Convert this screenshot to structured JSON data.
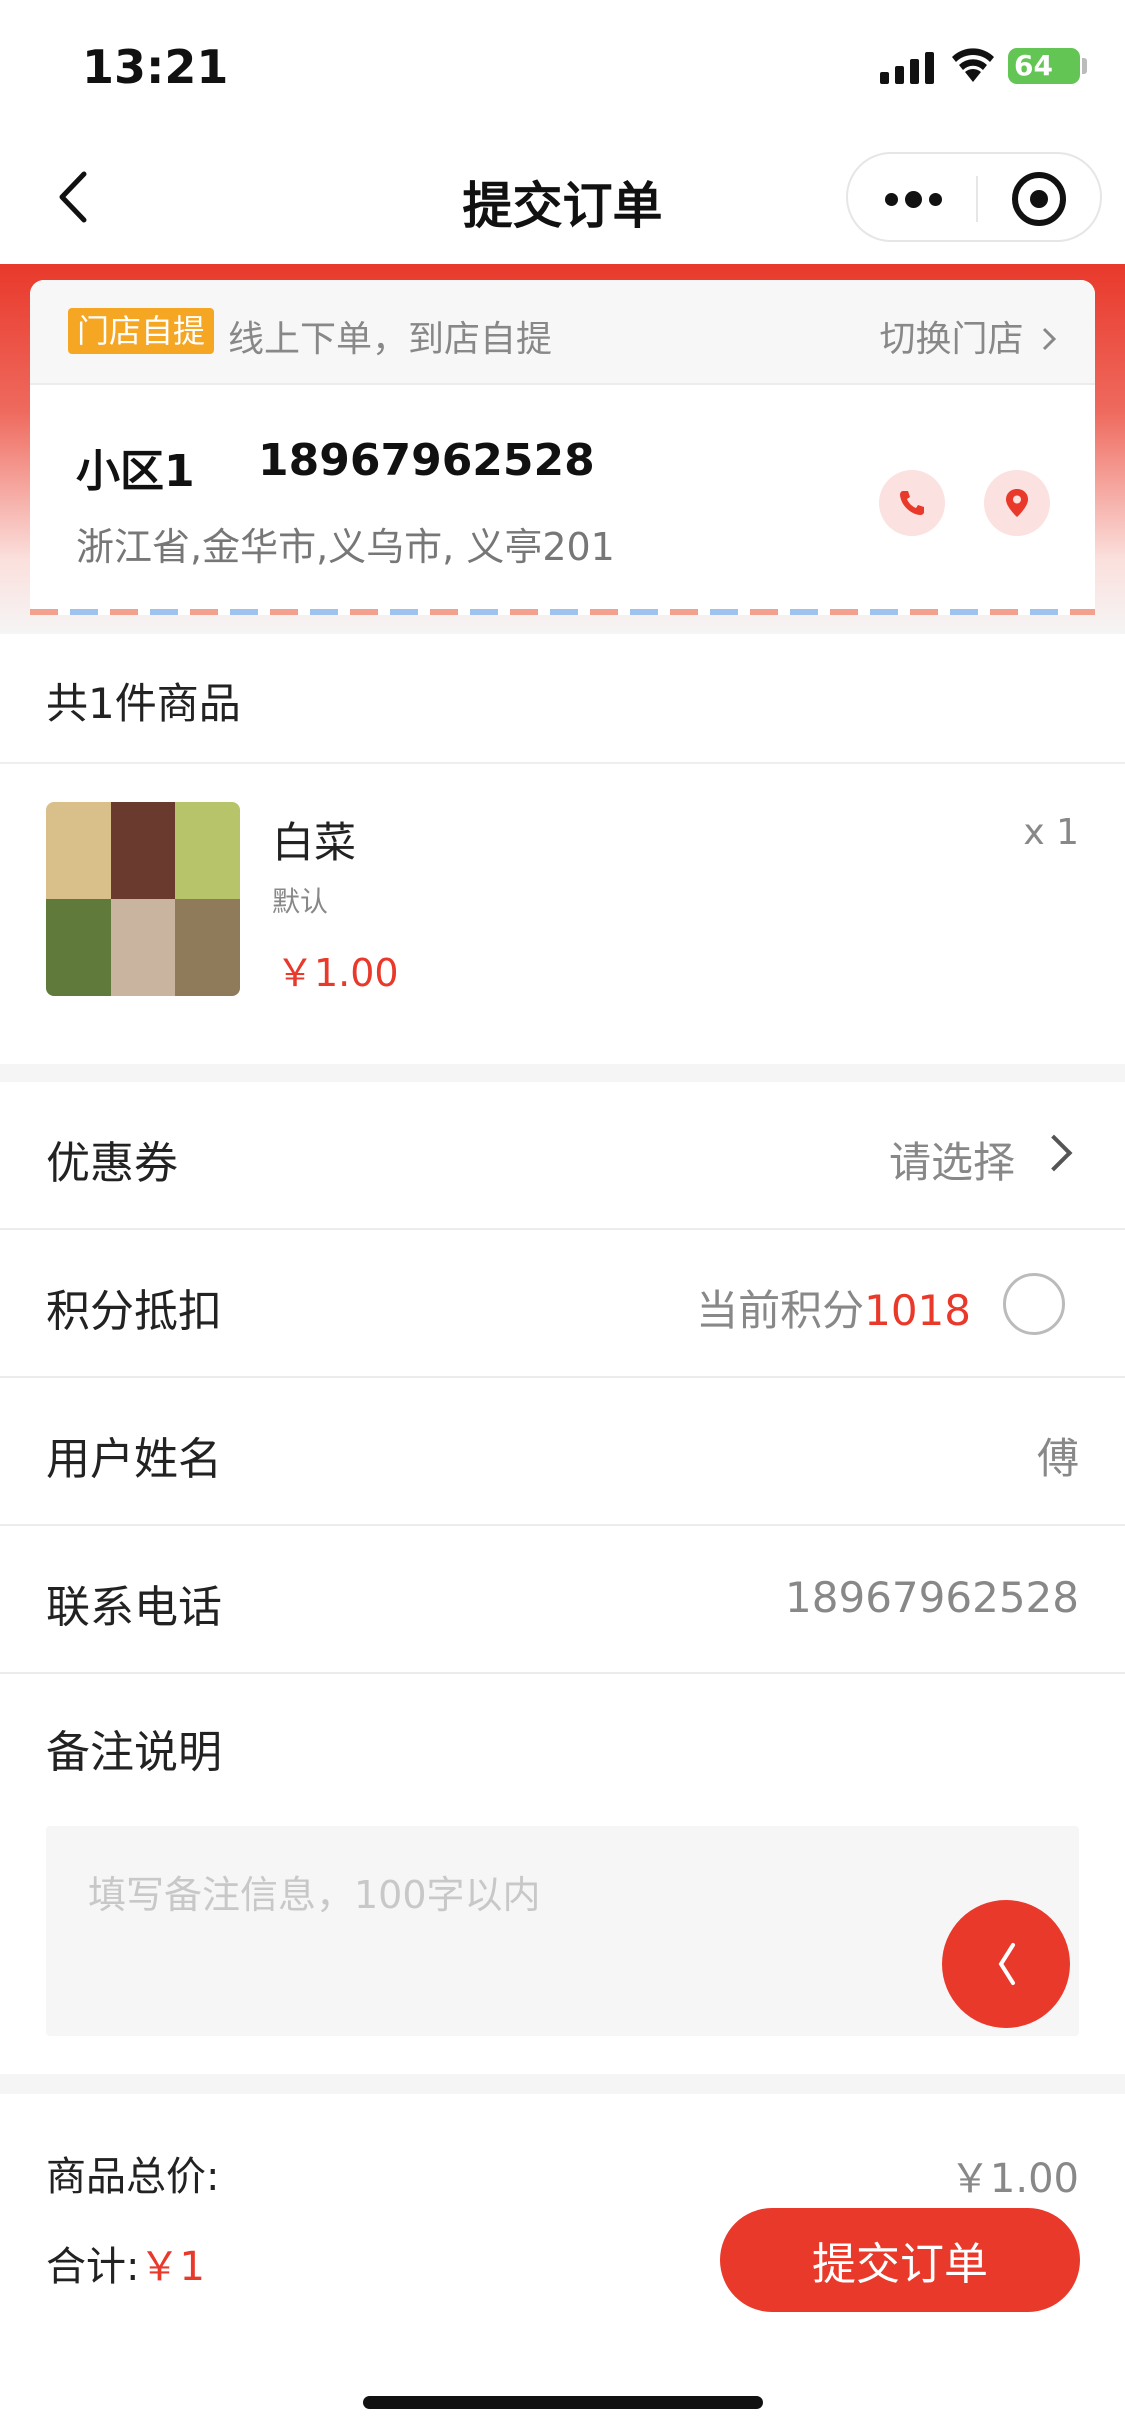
{
  "status_bar": {
    "time": "13:21",
    "battery": "64"
  },
  "nav": {
    "title": "提交订单",
    "back_icon": "chevron-left-icon",
    "more_icon": "more-dots-icon",
    "close_icon": "target-circle-icon"
  },
  "store": {
    "tag": "门店自提",
    "description": "线上下单，到店自提",
    "switch_label": "切换门店",
    "contact_name": "小区1",
    "contact_phone": "18967962528",
    "address": "浙江省,金华市,义乌市, 义亭201",
    "phone_icon": "phone-icon",
    "location_icon": "location-pin-icon"
  },
  "order": {
    "count_label": "共1件商品",
    "items": [
      {
        "name": "白菜",
        "spec": "默认",
        "price": "￥1.00",
        "quantity": "x 1"
      }
    ]
  },
  "form": {
    "coupon": {
      "label": "优惠券",
      "value": "请选择"
    },
    "points": {
      "label": "积分抵扣",
      "prefix": "当前积分",
      "value": "1018"
    },
    "user_name": {
      "label": "用户姓名",
      "value": "傅"
    },
    "phone": {
      "label": "联系电话",
      "value": "18967962528"
    },
    "remark": {
      "label": "备注说明",
      "placeholder": "填写备注信息，100字以内"
    }
  },
  "summary": {
    "total_label": "商品总价:",
    "total_value": "￥1.00",
    "sum_label": "合计:",
    "sum_value": "￥1",
    "submit_label": "提交订单"
  },
  "colors": {
    "accent": "#e8392b",
    "tag": "#f5a623"
  }
}
